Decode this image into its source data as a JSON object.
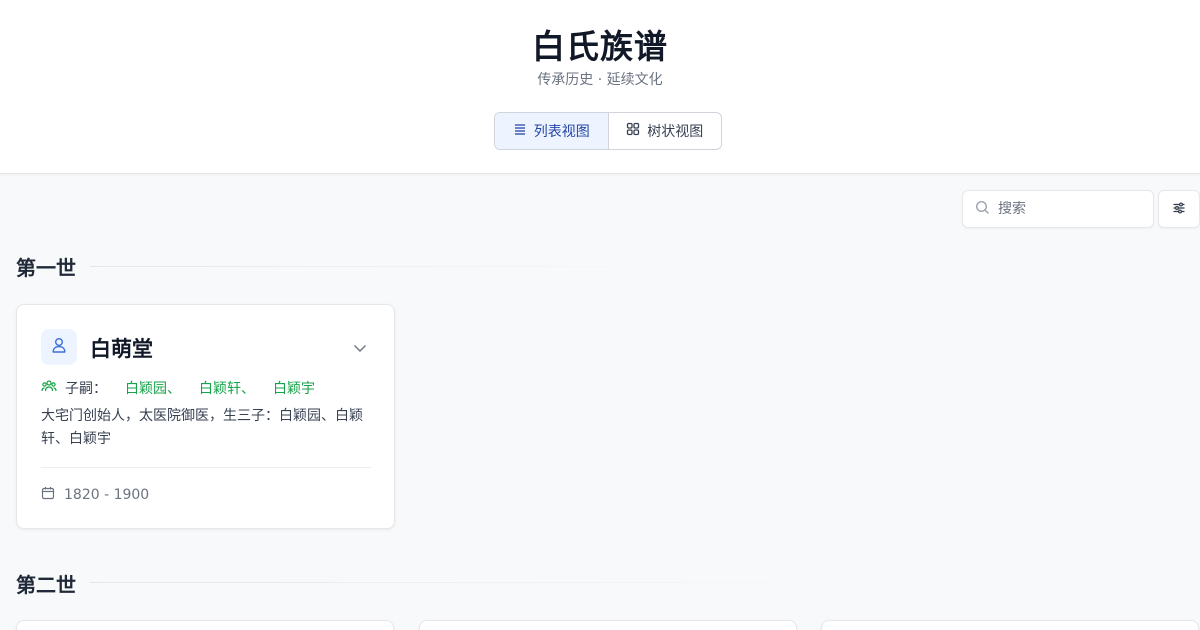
{
  "header": {
    "title": "白氏族谱",
    "subtitle": "传承历史 · 延续文化"
  },
  "view_toggle": {
    "list_label": "列表视图",
    "tree_label": "树状视图",
    "active": "list"
  },
  "search": {
    "placeholder": "搜索",
    "value": ""
  },
  "generations": [
    {
      "heading": "第一世",
      "members": [
        {
          "name": "白萌堂",
          "heirs_label": "子嗣：",
          "heirs": [
            "白颖园",
            "白颖轩",
            "白颖宇"
          ],
          "heir_separator": "、",
          "description": "大宅门创始人，太医院御医，生三子：白颖园、白颖轩、白颖宇",
          "dates": "1820 - 1900"
        }
      ]
    },
    {
      "heading": "第二世"
    }
  ],
  "colors": {
    "accent": "#2346a8",
    "heir_link": "#16a34a",
    "background": "#f8f9fa"
  },
  "icons": [
    "list-icon",
    "grid-icon",
    "search-icon",
    "filter-icon",
    "user-icon",
    "chevron-down-icon",
    "family-icon",
    "calendar-icon"
  ]
}
